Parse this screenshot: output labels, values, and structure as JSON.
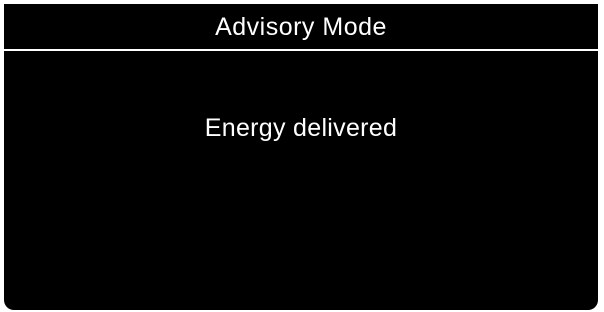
{
  "screen": {
    "title": "Advisory Mode",
    "message": "Energy delivered",
    "colors": {
      "background": "#000000",
      "text": "#ffffff",
      "rule": "#ffffff"
    }
  }
}
